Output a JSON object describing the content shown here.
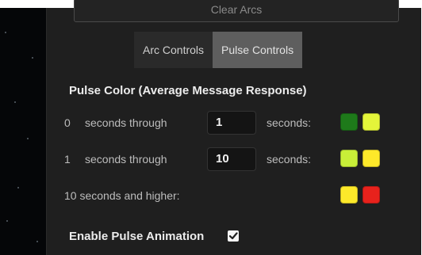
{
  "clear_arcs": {
    "label": "Clear Arcs"
  },
  "tabs": [
    {
      "label": "Arc Controls",
      "active": false
    },
    {
      "label": "Pulse Controls",
      "active": true
    }
  ],
  "pulse_color": {
    "title": "Pulse Color (Average Message Response)",
    "rows": [
      {
        "start": "0",
        "through_label": "seconds through",
        "end_value": "1",
        "suffix": "seconds:",
        "colors": [
          "#1e7a1a",
          "#e4f53a"
        ]
      },
      {
        "start": "1",
        "through_label": "seconds through",
        "end_value": "10",
        "suffix": "seconds:",
        "colors": [
          "#c8ef38",
          "#fde92a"
        ]
      },
      {
        "label": "10 seconds and higher:",
        "colors": [
          "#fde92a",
          "#e8221c"
        ]
      }
    ]
  },
  "enable_pulse": {
    "label": "Enable Pulse Animation",
    "checked": true
  }
}
